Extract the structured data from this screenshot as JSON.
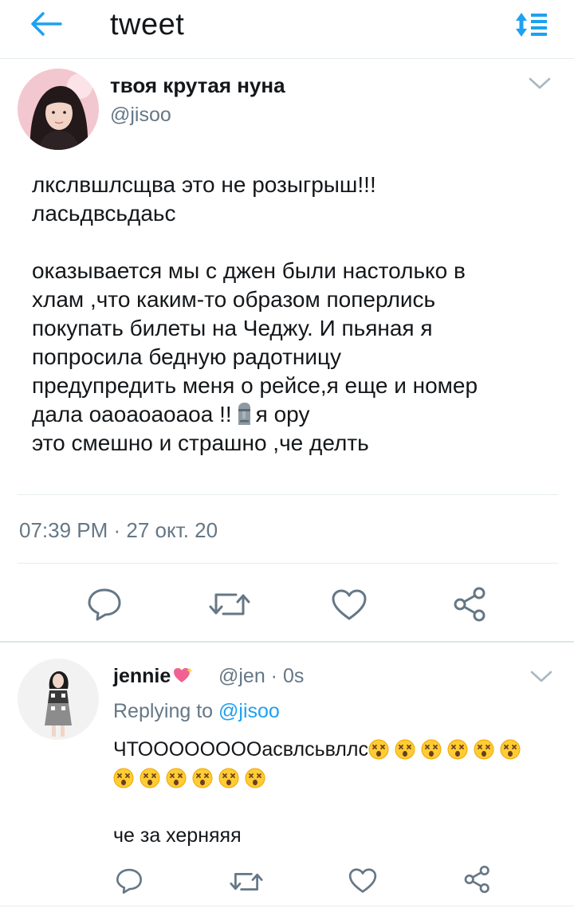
{
  "header": {
    "title": "tweet",
    "back_icon": "arrow-left-icon",
    "sort_icon": "sort-icon",
    "accent_color": "#1da1f2"
  },
  "tweet": {
    "author_name": "твоя крутая нуна",
    "author_handle": "@jisoo",
    "lines": [
      "лкслвшлсщва это не розыгрыш!!!",
      "ласьдвсьдаьс",
      "",
      "оказывается мы с джен были настолько в",
      "хлам ,что каким-то образом поперлись",
      "покупать билеты на Чеджу. И пьяная я",
      "попросила бедную радотницу",
      "предупредить меня о рейсе,я еще и номер"
    ],
    "line_emoji_before": "дала оаоаоаоаоа !!",
    "emoji_name": "moai-emoji",
    "line_emoji_after": "я ору",
    "last_line": "это смешно и страшно ,че делть",
    "timestamp": "07:39 PM · 27 окт. 20",
    "actions": [
      "reply-icon",
      "retweet-icon",
      "like-icon",
      "share-icon"
    ]
  },
  "reply": {
    "author_name": "jennie",
    "name_emoji": "sparkling-heart-emoji",
    "author_handle": "@jen · 0s",
    "replying_prefix": "Replying to",
    "replying_mention": "@jisoo",
    "text_start": "ЧТООООООООасвлсьвллс",
    "emoji_name": "dizzy-face-emoji",
    "emoji_count_line1": 6,
    "emoji_count_line2": 6,
    "text_end": "че за херняяя",
    "actions": [
      "reply-icon",
      "retweet-icon",
      "like-icon",
      "share-icon"
    ]
  },
  "colors": {
    "text": "#14171a",
    "secondary": "#657786",
    "divider": "#e6ecf0",
    "link": "#1da1f2"
  }
}
